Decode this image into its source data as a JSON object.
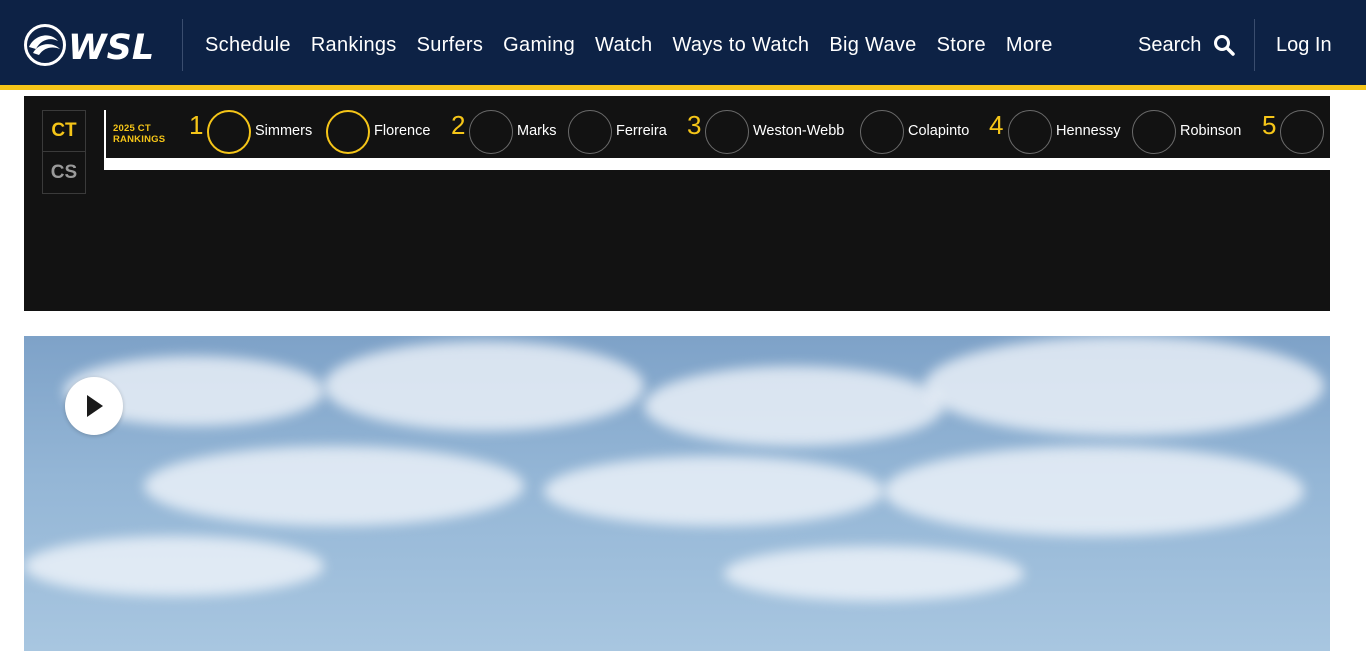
{
  "header": {
    "logo_text": "WSL",
    "nav": [
      "Schedule",
      "Rankings",
      "Surfers",
      "Gaming",
      "Watch",
      "Ways to Watch",
      "Big Wave",
      "Store",
      "More"
    ],
    "search_label": "Search",
    "login_label": "Log In"
  },
  "rankings": {
    "tours": [
      "CT",
      "CS"
    ],
    "active_tour": "CT",
    "title_line1": "2025 CT",
    "title_line2": "RANKINGS",
    "ranks": [
      "1",
      "2",
      "3",
      "4",
      "5"
    ],
    "surfers": [
      "Simmers",
      "Florence",
      "Marks",
      "Ferreira",
      "Weston-Webb",
      "Colapinto",
      "Hennessy",
      "Robinson"
    ]
  },
  "video": {
    "play_icon": "play-icon"
  },
  "colors": {
    "header_bg": "#0d2245",
    "accent": "#f5c518",
    "panel_bg": "#121212"
  }
}
